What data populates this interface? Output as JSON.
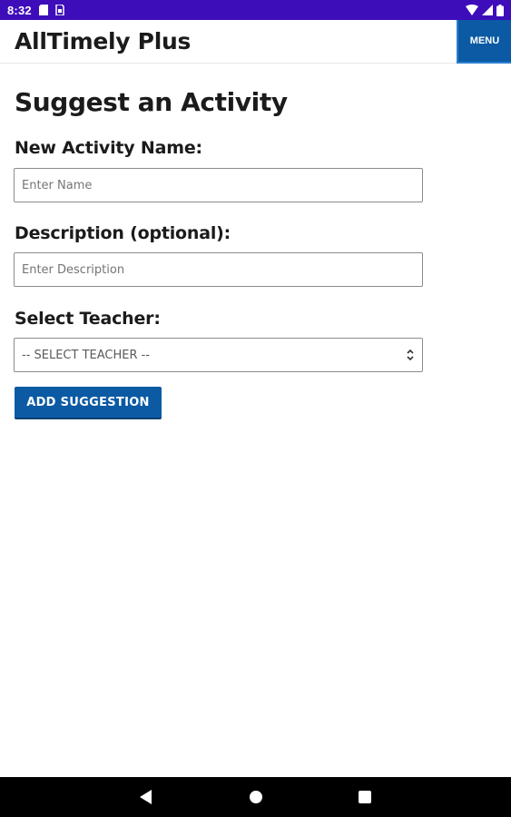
{
  "status_bar": {
    "time": "8:32",
    "icons_left": [
      "sd-card-icon",
      "sim-icon"
    ],
    "icons_right": [
      "wifi-icon",
      "signal-icon",
      "battery-icon"
    ],
    "background_color": "#3d0dba"
  },
  "header": {
    "app_title": "AllTimely Plus",
    "menu_label": "MENU"
  },
  "main": {
    "page_title": "Suggest an Activity",
    "activity_name": {
      "label": "New Activity Name:",
      "placeholder": "Enter Name",
      "value": ""
    },
    "description": {
      "label": "Description (optional):",
      "placeholder": "Enter Description",
      "value": ""
    },
    "teacher": {
      "label": "Select Teacher:",
      "selected": "-- SELECT TEACHER --"
    },
    "submit_label": "ADD SUGGESTION"
  },
  "nav_bar": {
    "icons": [
      "back-icon",
      "home-icon",
      "recents-icon"
    ]
  },
  "colors": {
    "accent": "#0b5aa3",
    "text": "#1b1b1b"
  }
}
